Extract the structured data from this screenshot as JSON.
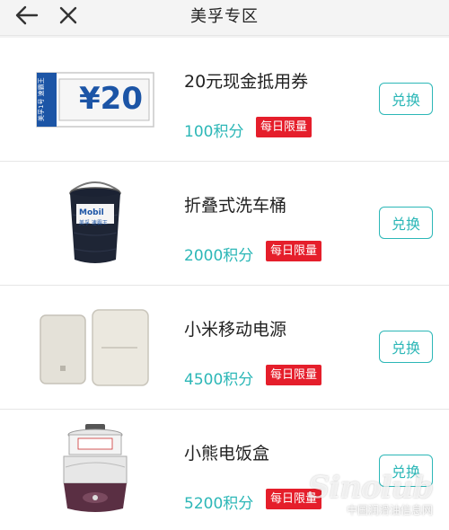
{
  "header": {
    "title": "美孚专区",
    "back_icon": "arrow-left-icon",
    "close_icon": "close-icon"
  },
  "colors": {
    "accent": "#2cb7b7",
    "badge": "#e51e2b"
  },
  "items": [
    {
      "name": "20元现金抵用券",
      "points": "100积分",
      "limit": "每日限量",
      "button": "兑换",
      "voucher_amount": "¥20",
      "voucher_side_text": "美孚1号 速霸王"
    },
    {
      "name": "折叠式洗车桶",
      "points": "2000积分",
      "limit": "每日限量",
      "button": "兑换",
      "logo_text": "Mobil",
      "logo_sub": "美孚 速霸王"
    },
    {
      "name": "小米移动电源",
      "points": "4500积分",
      "limit": "每日限量",
      "button": "兑换"
    },
    {
      "name": "小熊电饭盒",
      "points": "5200积分",
      "limit": "每日限量",
      "button": "兑换"
    }
  ],
  "watermark": {
    "logo": "Sinolub",
    "text": "中国润滑油信息网"
  }
}
